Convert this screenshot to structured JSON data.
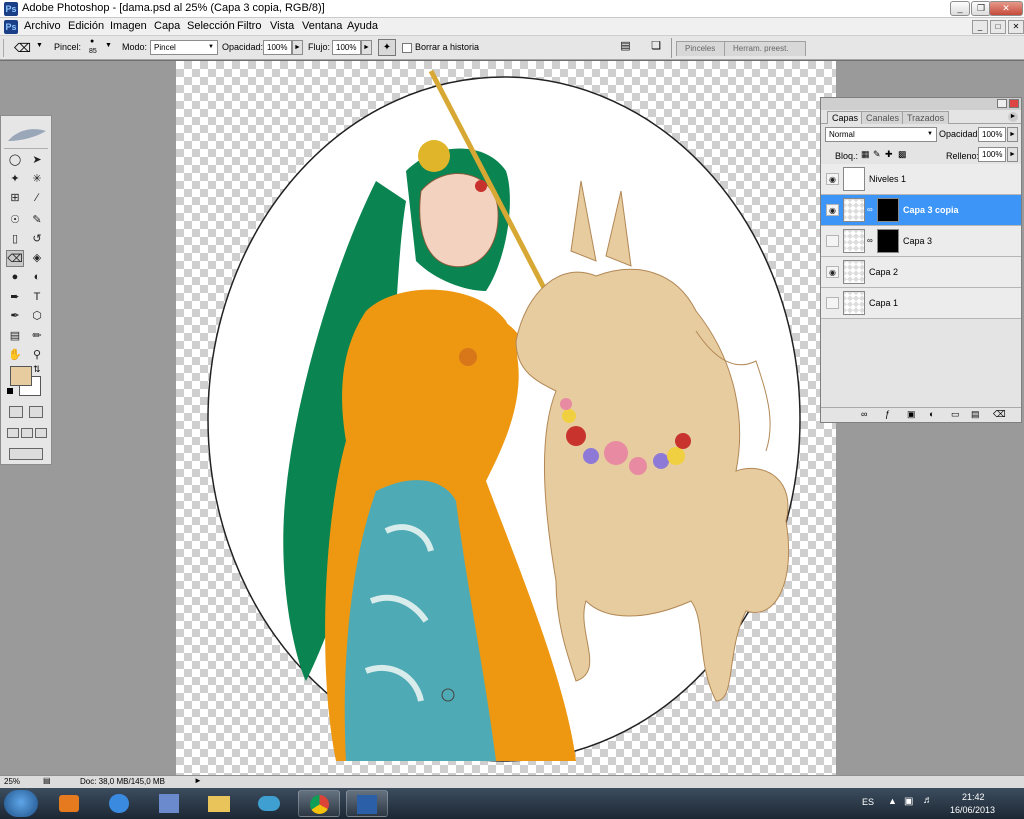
{
  "window": {
    "title": "Adobe Photoshop - [dama.psd al 25% (Capa 3 copia, RGB/8)]",
    "controls": [
      "_",
      "❐",
      "✕"
    ]
  },
  "menubar": {
    "items": [
      "Archivo",
      "Edición",
      "Imagen",
      "Capa",
      "Selección",
      "Filtro",
      "Vista",
      "Ventana",
      "Ayuda"
    ]
  },
  "options": {
    "brush_label": "Pincel:",
    "brush_size": "85",
    "mode_label": "Modo:",
    "mode_value": "Pincel",
    "opacity_label": "Opacidad:",
    "opacity_value": "100%",
    "flow_label": "Flujo:",
    "flow_value": "100%",
    "erase_history_label": "Borrar a historia",
    "palette_wells": [
      "Pinceles",
      "Herram. preest."
    ]
  },
  "toolbox": {
    "foreground_color": "#e6cc9e",
    "background_color": "#ffffff"
  },
  "layers_panel": {
    "tabs": [
      "Capas",
      "Canales",
      "Trazados"
    ],
    "blend_mode": "Normal",
    "opacity_label": "Opacidad:",
    "opacity_value": "100%",
    "lock_label": "Bloq.:",
    "fill_label": "Relleno:",
    "fill_value": "100%",
    "layers": [
      {
        "name": "Niveles 1",
        "visible": true,
        "selected": false
      },
      {
        "name": "Capa 3 copia",
        "visible": true,
        "selected": true
      },
      {
        "name": "Capa 3",
        "visible": false,
        "selected": false
      },
      {
        "name": "Capa 2",
        "visible": true,
        "selected": false
      },
      {
        "name": "Capa 1",
        "visible": false,
        "selected": false
      }
    ]
  },
  "statusbar": {
    "zoom": "25%",
    "doc_info": "Doc: 38,0 MB/145,0 MB"
  },
  "taskbar": {
    "language": "ES",
    "time": "21:42",
    "date": "16/06/2013"
  }
}
